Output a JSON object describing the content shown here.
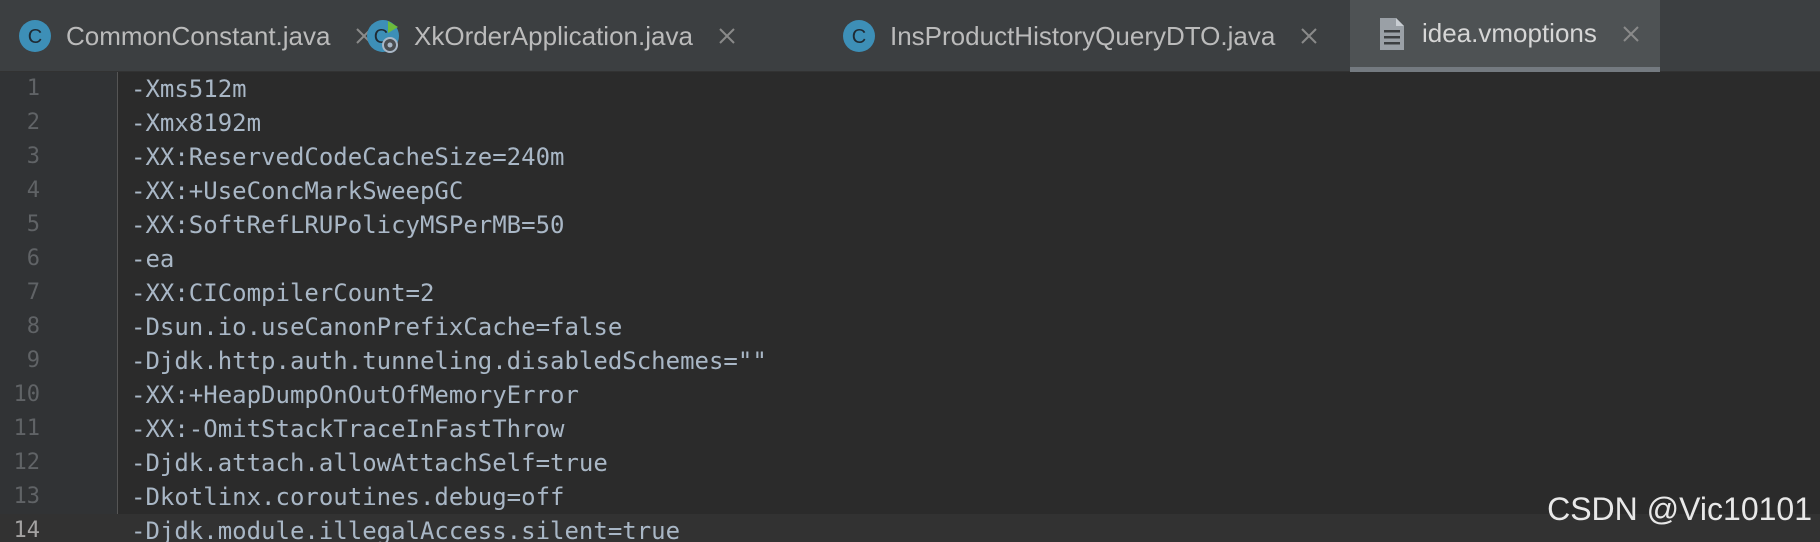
{
  "tabs": [
    {
      "label": "CommonConstant.java",
      "icon": "java-class-icon",
      "active": false
    },
    {
      "label": "XkOrderApplication.java",
      "icon": "spring-application-icon",
      "active": false
    },
    {
      "label": "InsProductHistoryQueryDTO.java",
      "icon": "java-class-icon",
      "active": false
    },
    {
      "label": "idea.vmoptions",
      "icon": "text-file-icon",
      "active": true
    }
  ],
  "editor": {
    "current_line": 14,
    "lines": [
      {
        "number": "1",
        "text": "-Xms512m"
      },
      {
        "number": "2",
        "text": "-Xmx8192m"
      },
      {
        "number": "3",
        "text": "-XX:ReservedCodeCacheSize=240m"
      },
      {
        "number": "4",
        "text": "-XX:+UseConcMarkSweepGC"
      },
      {
        "number": "5",
        "text": "-XX:SoftRefLRUPolicyMSPerMB=50"
      },
      {
        "number": "6",
        "text": "-ea"
      },
      {
        "number": "7",
        "text": "-XX:CICompilerCount=2"
      },
      {
        "number": "8",
        "text": "-Dsun.io.useCanonPrefixCache=false"
      },
      {
        "number": "9",
        "text": "-Djdk.http.auth.tunneling.disabledSchemes=\"\""
      },
      {
        "number": "10",
        "text": "-XX:+HeapDumpOnOutOfMemoryError"
      },
      {
        "number": "11",
        "text": "-XX:-OmitStackTraceInFastThrow"
      },
      {
        "number": "12",
        "text": "-Djdk.attach.allowAttachSelf=true"
      },
      {
        "number": "13",
        "text": "-Dkotlinx.coroutines.debug=off"
      },
      {
        "number": "14",
        "text": "-Djdk.module.illegalAccess.silent=true"
      }
    ]
  },
  "watermark": "CSDN @Vic10101",
  "colors": {
    "tab_bar_bg": "#3c3f41",
    "active_tab_bg": "#4e5254",
    "editor_bg": "#2b2b2b",
    "gutter_bg": "#313335",
    "code_text": "#a9b7c6",
    "java_icon": "#3d8fb7",
    "spring_green": "#6cbb3c"
  }
}
